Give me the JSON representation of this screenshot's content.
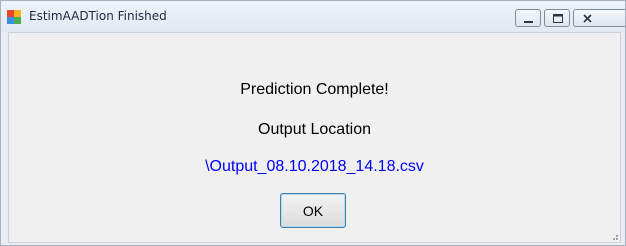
{
  "window": {
    "title": "EstimAADTion Finished",
    "controls": {
      "minimize_icon": "minimize-icon",
      "maximize_icon": "maximize-icon",
      "close_icon": "close-icon"
    }
  },
  "dialog": {
    "heading": "Prediction Complete!",
    "output_label": "Output Location",
    "output_path": "\\Output_08.10.2018_14.18.csv",
    "ok_label": "OK"
  },
  "colors": {
    "link": "#0000ff",
    "button_focus_border": "#3c7fb1"
  }
}
